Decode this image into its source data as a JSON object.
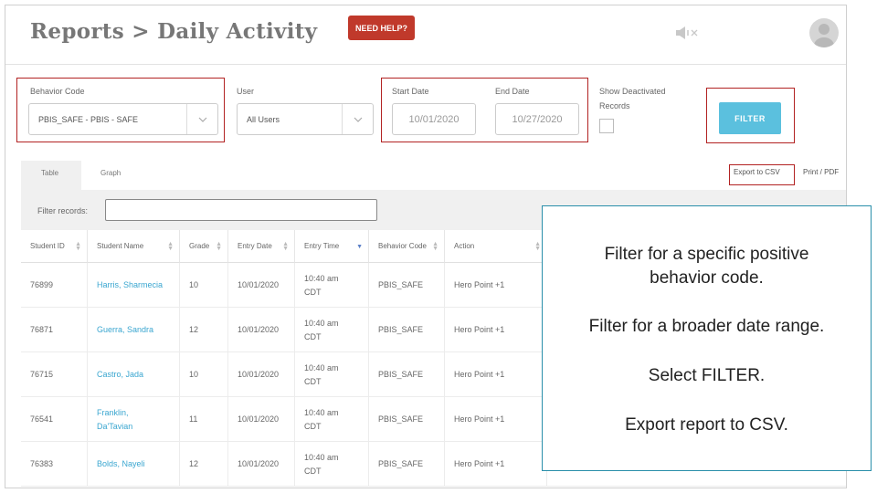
{
  "header": {
    "title": "Reports > Daily Activity",
    "help_label": "NEED HELP?"
  },
  "filters": {
    "behavior_code": {
      "label": "Behavior Code",
      "value": "PBIS_SAFE - PBIS - SAFE"
    },
    "user": {
      "label": "User",
      "value": "All Users"
    },
    "start_date": {
      "label": "Start Date",
      "value": "10/01/2020"
    },
    "end_date": {
      "label": "End Date",
      "value": "10/27/2020"
    },
    "show_deactivated": {
      "label_line1": "Show Deactivated",
      "label_line2": "Records"
    },
    "filter_button": "FILTER"
  },
  "tabs": [
    {
      "label": "Table"
    },
    {
      "label": "Graph"
    }
  ],
  "actions": {
    "export_csv": "Export to CSV",
    "print_pdf": "Print / PDF"
  },
  "table": {
    "filter_label": "Filter records:",
    "columns": [
      "Student ID",
      "Student Name",
      "Grade",
      "Entry Date",
      "Entry Time",
      "Behavior Code",
      "Action"
    ],
    "rows": [
      {
        "id": "76899",
        "name": "Harris, Sharmecia",
        "grade": "10",
        "date": "10/01/2020",
        "time1": "10:40 am",
        "time2": "CDT",
        "code": "PBIS_SAFE",
        "action": "Hero Point +1"
      },
      {
        "id": "76871",
        "name": "Guerra, Sandra",
        "grade": "12",
        "date": "10/01/2020",
        "time1": "10:40 am",
        "time2": "CDT",
        "code": "PBIS_SAFE",
        "action": "Hero Point +1"
      },
      {
        "id": "76715",
        "name": "Castro, Jada",
        "grade": "10",
        "date": "10/01/2020",
        "time1": "10:40 am",
        "time2": "CDT",
        "code": "PBIS_SAFE",
        "action": "Hero Point +1"
      },
      {
        "id": "76541",
        "name1": "Franklin,",
        "name2": "Da'Tavian",
        "grade": "11",
        "date": "10/01/2020",
        "time1": "10:40 am",
        "time2": "CDT",
        "code": "PBIS_SAFE",
        "action": "Hero Point +1"
      },
      {
        "id": "76383",
        "name": "Bolds, Nayeli",
        "grade": "12",
        "date": "10/01/2020",
        "time1": "10:40 am",
        "time2": "CDT",
        "code": "PBIS_SAFE",
        "action": "Hero Point +1"
      }
    ]
  },
  "callout": {
    "line1": "Filter for a specific positive",
    "line2": "behavior code.",
    "line3": "Filter for a broader date range.",
    "line4": "Select FILTER.",
    "line5": "Export report to CSV."
  },
  "colors": {
    "help_button": "#c0392b",
    "filter_button": "#5bc0de",
    "highlight_box": "#b22222",
    "callout_border": "#2a8faa",
    "link": "#3aa6d0"
  }
}
